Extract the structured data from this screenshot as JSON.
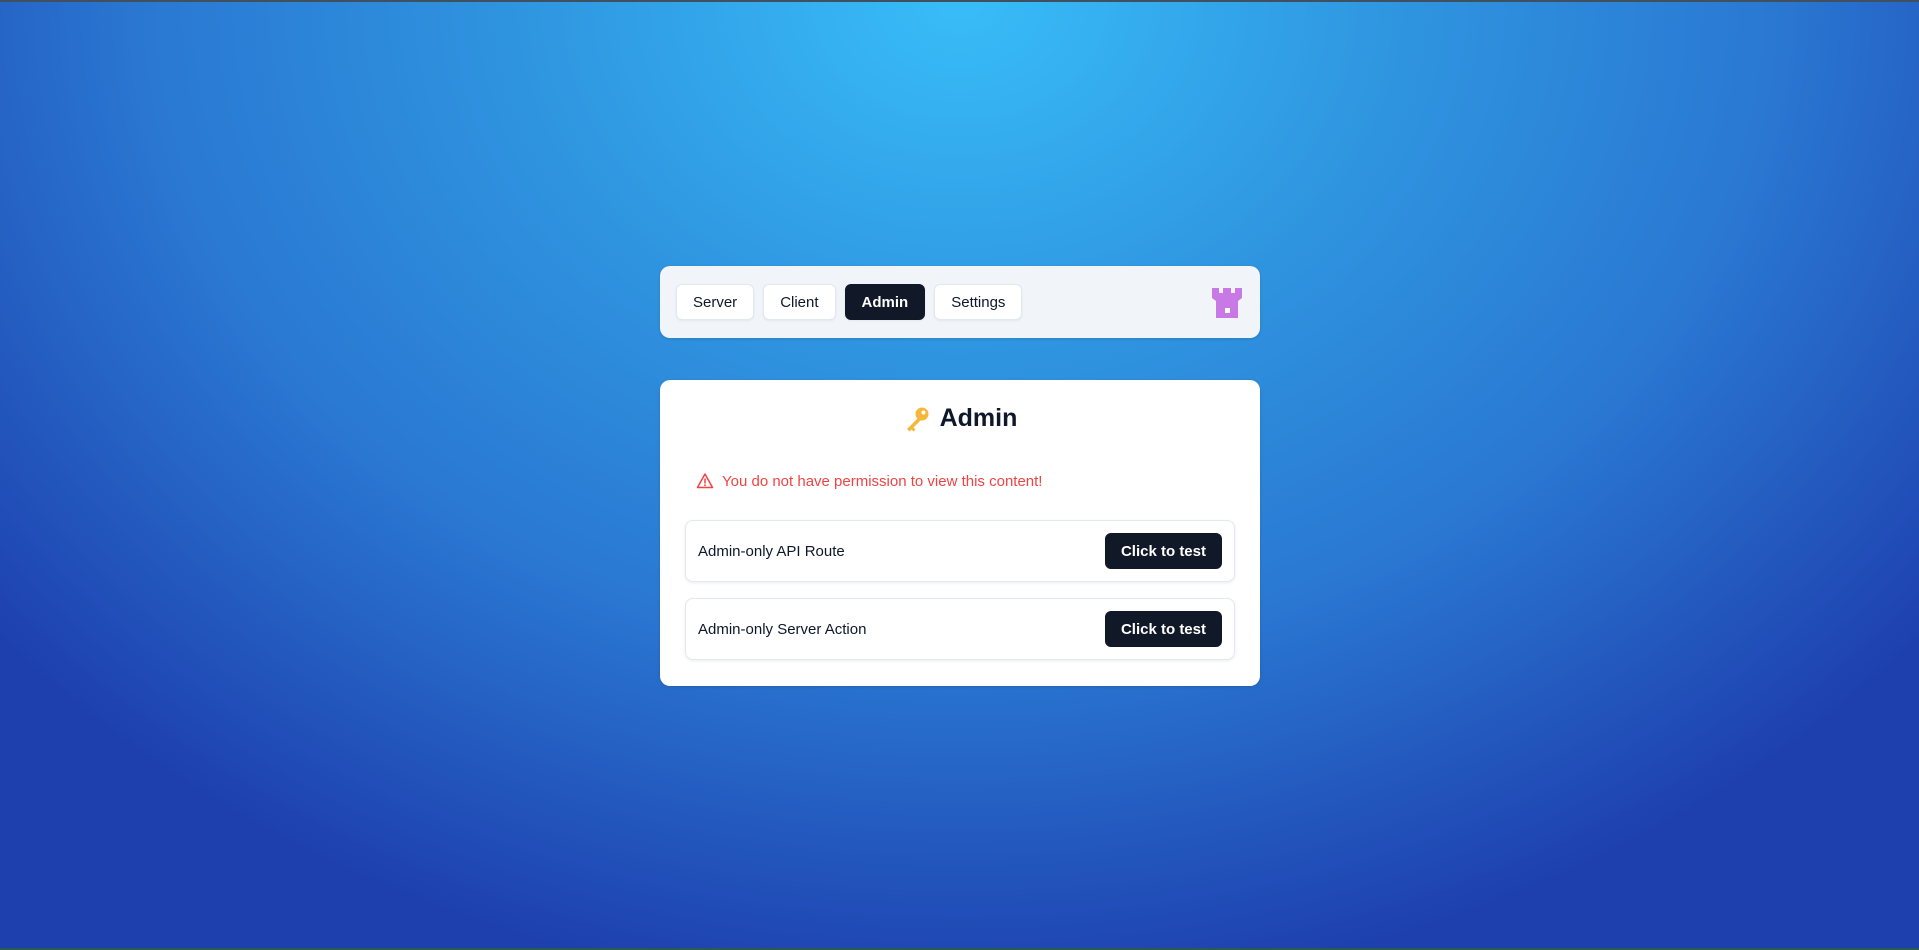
{
  "nav": {
    "items": [
      {
        "label": "Server",
        "active": false
      },
      {
        "label": "Client",
        "active": false
      },
      {
        "label": "Admin",
        "active": true
      },
      {
        "label": "Settings",
        "active": false
      }
    ],
    "logo_icon": "castle-icon"
  },
  "main": {
    "title_icon": "key-icon",
    "title": "Admin",
    "alert": {
      "icon": "warning-icon",
      "text": "You do not have permission to view this content!"
    },
    "tests": [
      {
        "label": "Admin-only API Route",
        "button_label": "Click to test"
      },
      {
        "label": "Admin-only Server Action",
        "button_label": "Click to test"
      }
    ]
  },
  "colors": {
    "accent_dark": "#111827",
    "error": "#ef4444",
    "key": "#f4b73a",
    "castle": "#c879e6",
    "background_top": "#38bdf8",
    "background_bottom": "#1e40af"
  }
}
